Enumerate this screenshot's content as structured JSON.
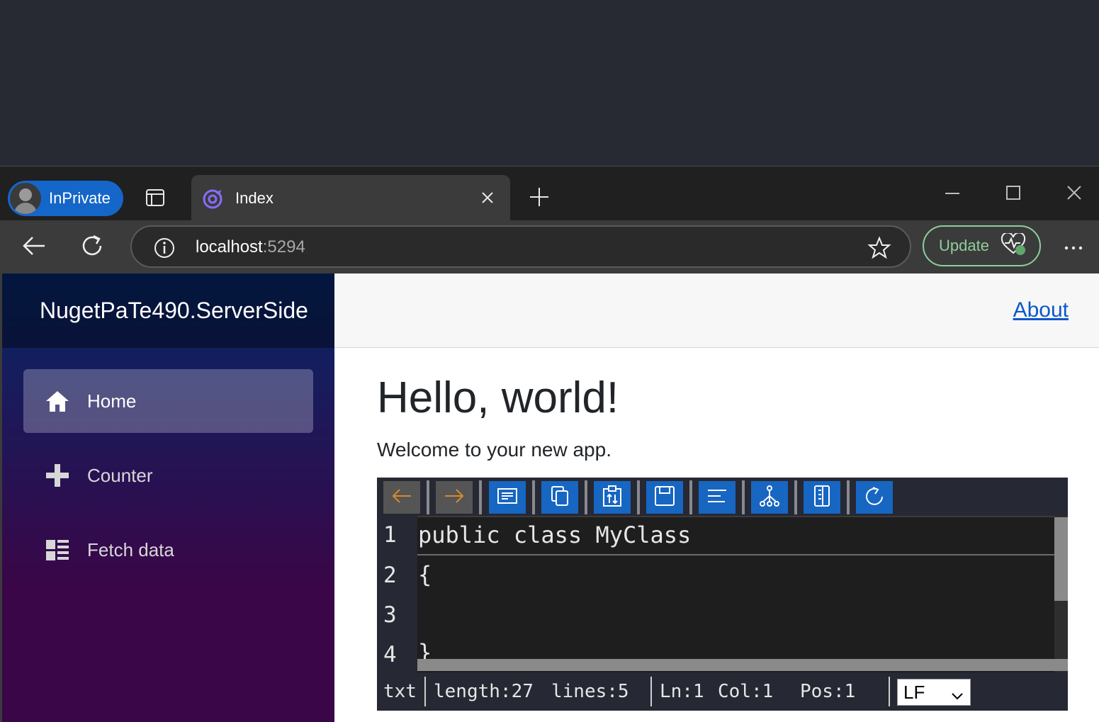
{
  "browser": {
    "profile_label": "InPrivate",
    "tab_title": "Index",
    "address": {
      "host": "localhost",
      "port": ":5294"
    },
    "update_label": "Update"
  },
  "app": {
    "brand": "NugetPaTe490.ServerSide",
    "about_link": "About",
    "nav": [
      {
        "label": "Home",
        "icon": "home-icon",
        "active": true
      },
      {
        "label": "Counter",
        "icon": "plus-icon",
        "active": false
      },
      {
        "label": "Fetch data",
        "icon": "list-icon",
        "active": false
      }
    ],
    "heading": "Hello, world!",
    "welcome": "Welcome to your new app."
  },
  "editor": {
    "toolbar": [
      "undo-icon",
      "redo-icon",
      "format-icon",
      "copy-icon",
      "paste-icon",
      "save-icon",
      "align-left-icon",
      "tree-icon",
      "document-icon",
      "refresh-icon"
    ],
    "line_numbers": [
      "1",
      "2",
      "3",
      "4"
    ],
    "lines": [
      "public class MyClass",
      "{",
      "",
      "}"
    ],
    "status": {
      "mode": "txt",
      "length": "length:27",
      "lines": "lines:5",
      "ln": "Ln:1",
      "col": "Col:1",
      "pos": "Pos:1",
      "eol": "LF"
    }
  }
}
